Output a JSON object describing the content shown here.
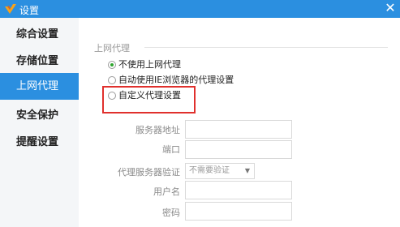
{
  "window": {
    "title": "设置",
    "accent_color": "#2b8fe0",
    "icons": {
      "logo": "app-logo-icon",
      "close": "close-icon"
    }
  },
  "sidebar": {
    "items": [
      {
        "label": "综合设置",
        "active": false
      },
      {
        "label": "存储位置",
        "active": false
      },
      {
        "label": "上网代理",
        "active": true
      },
      {
        "label": "安全保护",
        "active": false
      },
      {
        "label": "提醒设置",
        "active": false
      }
    ]
  },
  "proxy": {
    "group_title": "上网代理",
    "options": [
      {
        "label": "不使用上网代理",
        "selected": true
      },
      {
        "label": "自动使用IE浏览器的代理设置",
        "selected": false
      },
      {
        "label": "自定义代理设置",
        "selected": false
      }
    ],
    "highlight_color": "#e0302d",
    "fields": {
      "server_label": "服务器地址",
      "port_label": "端口",
      "auth_label": "代理服务器验证",
      "auth_value": "不需要验证",
      "username_label": "用户名",
      "password_label": "密码"
    }
  }
}
